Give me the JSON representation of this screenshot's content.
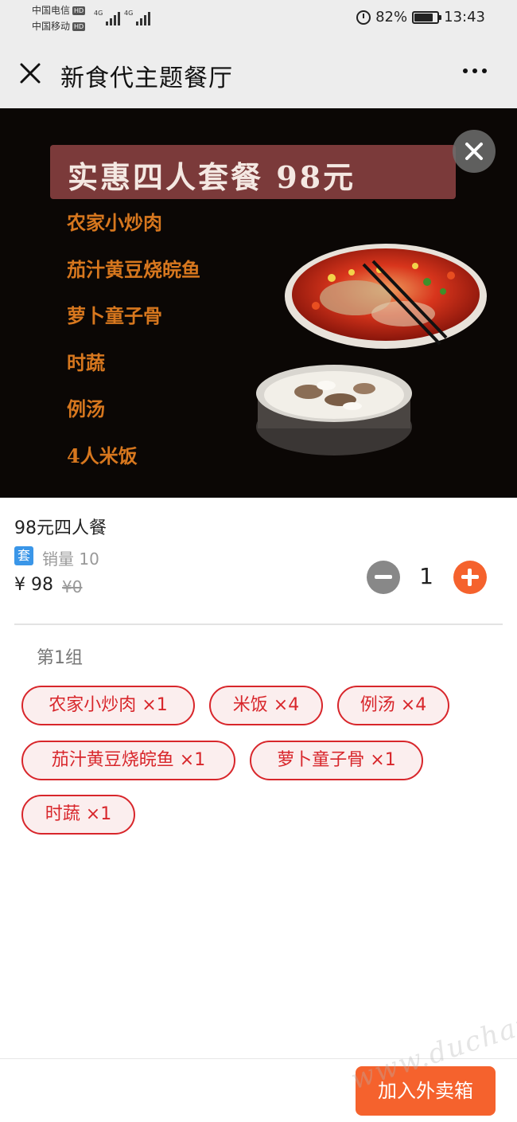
{
  "status_bar": {
    "carrier1": "中国电信",
    "carrier2": "中国移动",
    "hd_badge": "HD",
    "network1": "4G",
    "network2": "4G",
    "battery_percent": "82%",
    "battery_level": 0.82,
    "time": "13:43"
  },
  "nav": {
    "title": "新食代主题餐厅"
  },
  "banner": {
    "headline": "实惠四人套餐  98元",
    "items": [
      "农家小炒肉",
      "茄汁黄豆烧皖鱼",
      "萝卜童子骨",
      "时蔬",
      "例汤",
      "4人米饭"
    ]
  },
  "product": {
    "name": "98元四人餐",
    "tag": "套",
    "sales": "销量 10",
    "price": "¥ 98",
    "original_price": "¥0",
    "quantity": "1"
  },
  "group": {
    "title": "第1组",
    "chips": [
      "农家小炒肉 ×1",
      "米饭 ×4",
      "例汤 ×4",
      "茄汁黄豆烧皖鱼 ×1",
      "萝卜童子骨 ×1",
      "时蔬 ×1"
    ]
  },
  "footer": {
    "add_button": "加入外卖箱",
    "watermark": "www.duchai..."
  },
  "colors": {
    "accent": "#f5622d",
    "chip_red": "#d8262b",
    "tag_blue": "#3a96e8",
    "banner_text": "#d7771e"
  }
}
